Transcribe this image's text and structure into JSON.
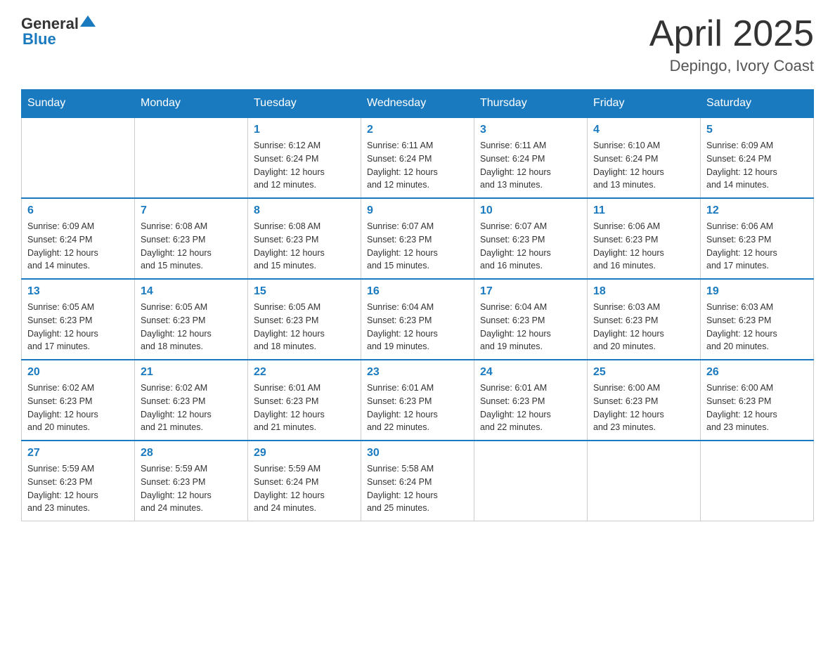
{
  "header": {
    "logo": {
      "general": "General",
      "blue": "Blue"
    },
    "title": "April 2025",
    "location": "Depingo, Ivory Coast"
  },
  "calendar": {
    "days": [
      "Sunday",
      "Monday",
      "Tuesday",
      "Wednesday",
      "Thursday",
      "Friday",
      "Saturday"
    ],
    "weeks": [
      [
        {
          "day": "",
          "info": ""
        },
        {
          "day": "",
          "info": ""
        },
        {
          "day": "1",
          "info": "Sunrise: 6:12 AM\nSunset: 6:24 PM\nDaylight: 12 hours\nand 12 minutes."
        },
        {
          "day": "2",
          "info": "Sunrise: 6:11 AM\nSunset: 6:24 PM\nDaylight: 12 hours\nand 12 minutes."
        },
        {
          "day": "3",
          "info": "Sunrise: 6:11 AM\nSunset: 6:24 PM\nDaylight: 12 hours\nand 13 minutes."
        },
        {
          "day": "4",
          "info": "Sunrise: 6:10 AM\nSunset: 6:24 PM\nDaylight: 12 hours\nand 13 minutes."
        },
        {
          "day": "5",
          "info": "Sunrise: 6:09 AM\nSunset: 6:24 PM\nDaylight: 12 hours\nand 14 minutes."
        }
      ],
      [
        {
          "day": "6",
          "info": "Sunrise: 6:09 AM\nSunset: 6:24 PM\nDaylight: 12 hours\nand 14 minutes."
        },
        {
          "day": "7",
          "info": "Sunrise: 6:08 AM\nSunset: 6:23 PM\nDaylight: 12 hours\nand 15 minutes."
        },
        {
          "day": "8",
          "info": "Sunrise: 6:08 AM\nSunset: 6:23 PM\nDaylight: 12 hours\nand 15 minutes."
        },
        {
          "day": "9",
          "info": "Sunrise: 6:07 AM\nSunset: 6:23 PM\nDaylight: 12 hours\nand 15 minutes."
        },
        {
          "day": "10",
          "info": "Sunrise: 6:07 AM\nSunset: 6:23 PM\nDaylight: 12 hours\nand 16 minutes."
        },
        {
          "day": "11",
          "info": "Sunrise: 6:06 AM\nSunset: 6:23 PM\nDaylight: 12 hours\nand 16 minutes."
        },
        {
          "day": "12",
          "info": "Sunrise: 6:06 AM\nSunset: 6:23 PM\nDaylight: 12 hours\nand 17 minutes."
        }
      ],
      [
        {
          "day": "13",
          "info": "Sunrise: 6:05 AM\nSunset: 6:23 PM\nDaylight: 12 hours\nand 17 minutes."
        },
        {
          "day": "14",
          "info": "Sunrise: 6:05 AM\nSunset: 6:23 PM\nDaylight: 12 hours\nand 18 minutes."
        },
        {
          "day": "15",
          "info": "Sunrise: 6:05 AM\nSunset: 6:23 PM\nDaylight: 12 hours\nand 18 minutes."
        },
        {
          "day": "16",
          "info": "Sunrise: 6:04 AM\nSunset: 6:23 PM\nDaylight: 12 hours\nand 19 minutes."
        },
        {
          "day": "17",
          "info": "Sunrise: 6:04 AM\nSunset: 6:23 PM\nDaylight: 12 hours\nand 19 minutes."
        },
        {
          "day": "18",
          "info": "Sunrise: 6:03 AM\nSunset: 6:23 PM\nDaylight: 12 hours\nand 20 minutes."
        },
        {
          "day": "19",
          "info": "Sunrise: 6:03 AM\nSunset: 6:23 PM\nDaylight: 12 hours\nand 20 minutes."
        }
      ],
      [
        {
          "day": "20",
          "info": "Sunrise: 6:02 AM\nSunset: 6:23 PM\nDaylight: 12 hours\nand 20 minutes."
        },
        {
          "day": "21",
          "info": "Sunrise: 6:02 AM\nSunset: 6:23 PM\nDaylight: 12 hours\nand 21 minutes."
        },
        {
          "day": "22",
          "info": "Sunrise: 6:01 AM\nSunset: 6:23 PM\nDaylight: 12 hours\nand 21 minutes."
        },
        {
          "day": "23",
          "info": "Sunrise: 6:01 AM\nSunset: 6:23 PM\nDaylight: 12 hours\nand 22 minutes."
        },
        {
          "day": "24",
          "info": "Sunrise: 6:01 AM\nSunset: 6:23 PM\nDaylight: 12 hours\nand 22 minutes."
        },
        {
          "day": "25",
          "info": "Sunrise: 6:00 AM\nSunset: 6:23 PM\nDaylight: 12 hours\nand 23 minutes."
        },
        {
          "day": "26",
          "info": "Sunrise: 6:00 AM\nSunset: 6:23 PM\nDaylight: 12 hours\nand 23 minutes."
        }
      ],
      [
        {
          "day": "27",
          "info": "Sunrise: 5:59 AM\nSunset: 6:23 PM\nDaylight: 12 hours\nand 23 minutes."
        },
        {
          "day": "28",
          "info": "Sunrise: 5:59 AM\nSunset: 6:23 PM\nDaylight: 12 hours\nand 24 minutes."
        },
        {
          "day": "29",
          "info": "Sunrise: 5:59 AM\nSunset: 6:24 PM\nDaylight: 12 hours\nand 24 minutes."
        },
        {
          "day": "30",
          "info": "Sunrise: 5:58 AM\nSunset: 6:24 PM\nDaylight: 12 hours\nand 25 minutes."
        },
        {
          "day": "",
          "info": ""
        },
        {
          "day": "",
          "info": ""
        },
        {
          "day": "",
          "info": ""
        }
      ]
    ]
  }
}
